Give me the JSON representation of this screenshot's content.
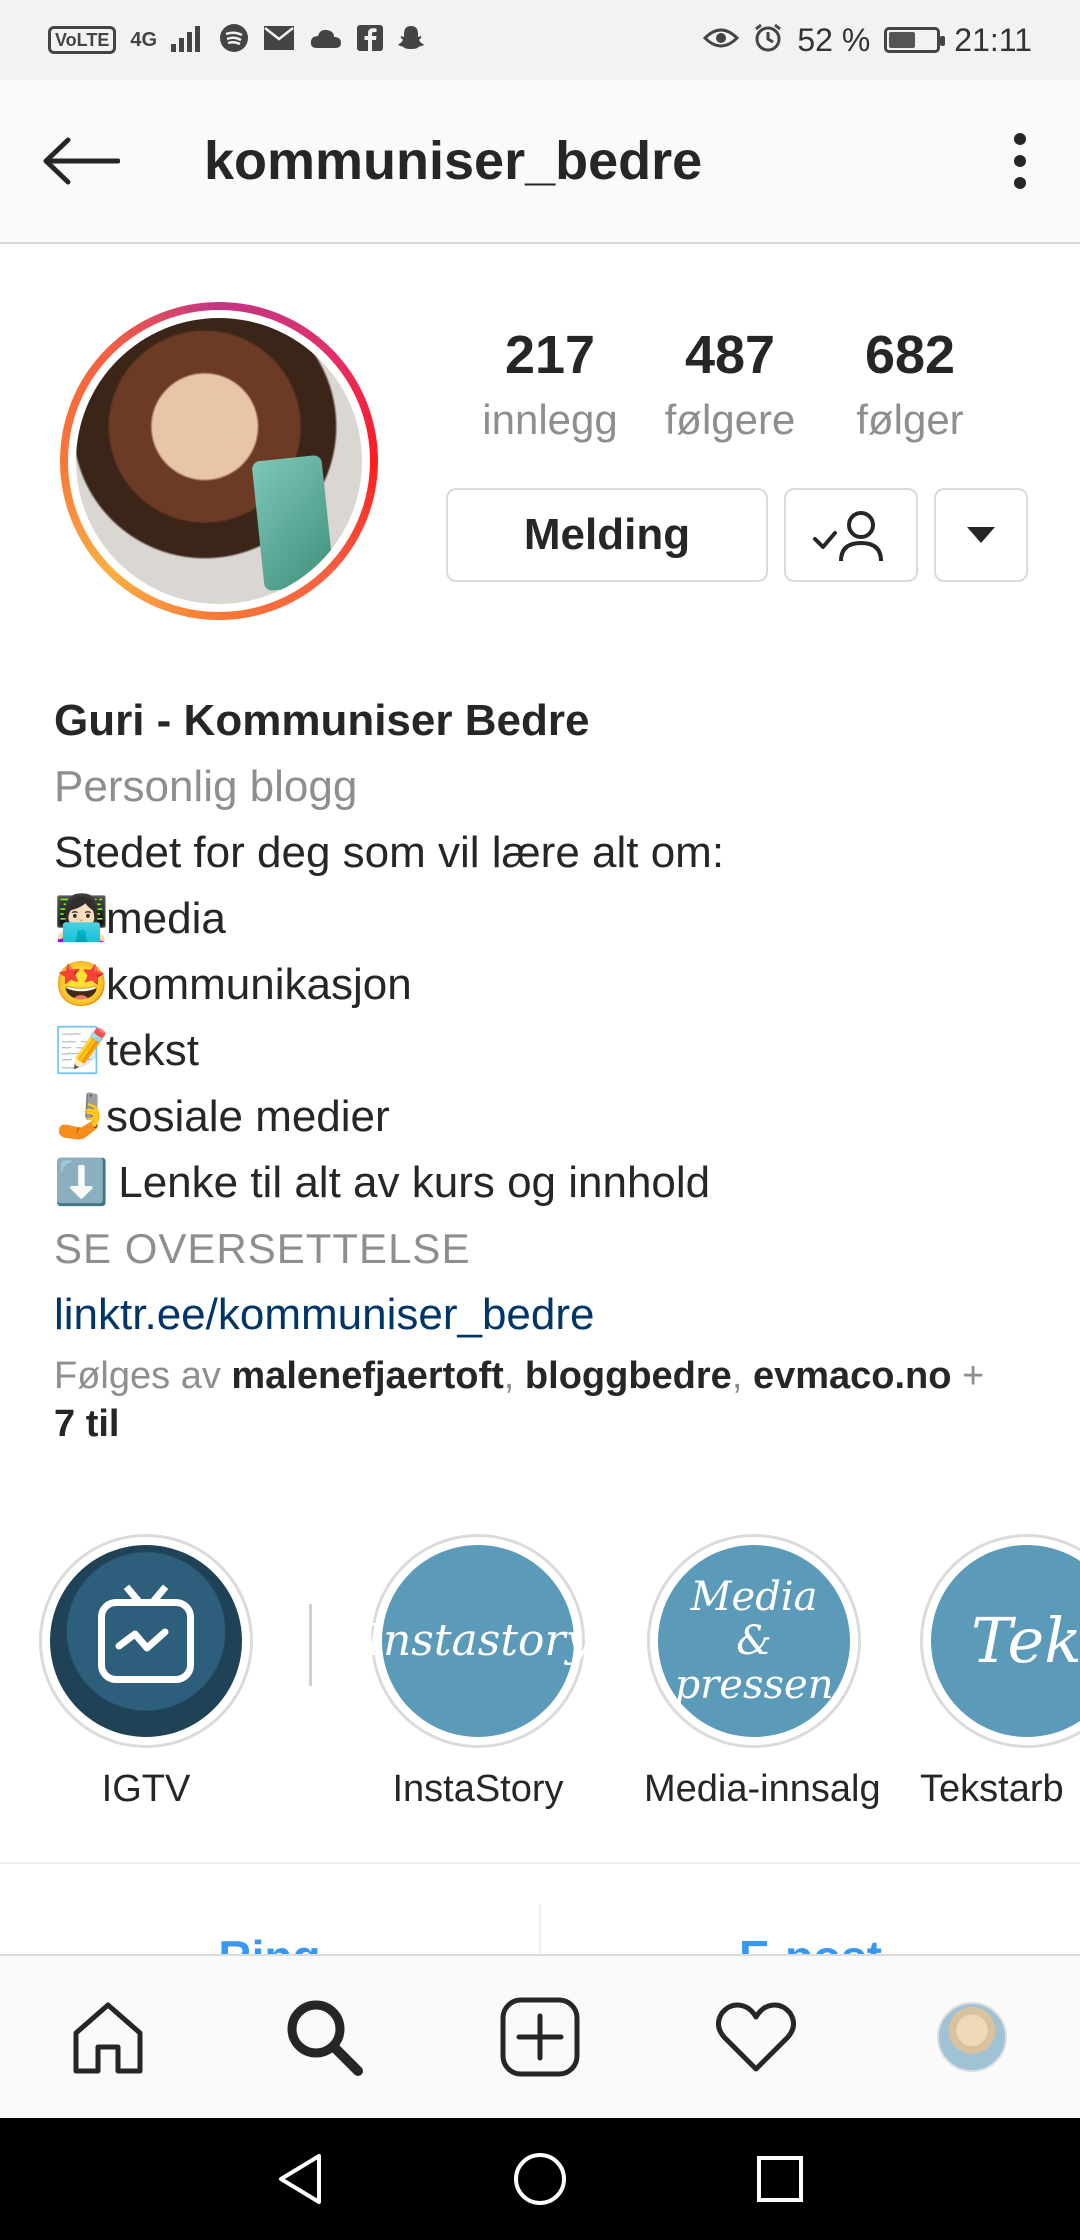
{
  "status_bar": {
    "volte": "VoLTE",
    "network": "4G",
    "battery_percent": "52 %",
    "battery_level": 0.52,
    "time": "21:11"
  },
  "header": {
    "title": "kommuniser_bedre"
  },
  "profile": {
    "stats": [
      {
        "count": "217",
        "label": "innlegg"
      },
      {
        "count": "487",
        "label": "følgere"
      },
      {
        "count": "682",
        "label": "følger"
      }
    ],
    "message_button": "Melding"
  },
  "bio": {
    "name": "Guri - Kommuniser Bedre",
    "category": "Personlig blogg",
    "intro": "Stedet for deg som vil lære alt om:",
    "lines": [
      {
        "emoji": "👩🏻‍💻",
        "text": "media"
      },
      {
        "emoji": "🤩",
        "text": "kommunikasjon"
      },
      {
        "emoji": "📝",
        "text": "tekst"
      },
      {
        "emoji": "🤳",
        "text": "sosiale medier"
      },
      {
        "emoji": "⬇️",
        "text": " Lenke til alt av kurs og innhold"
      }
    ],
    "translate": "SE OVERSETTELSE",
    "link": "linktr.ee/kommuniser_bedre"
  },
  "followed_by": {
    "prefix": "Følges av ",
    "users": [
      "malenefjaertoft",
      "bloggbedre",
      "evmaco.no"
    ],
    "sep": ", ",
    "plus": " + ",
    "more": "7 til"
  },
  "highlights": [
    {
      "label": "IGTV",
      "cover_text": ""
    },
    {
      "label": "InstaStory",
      "cover_text": "Instastory"
    },
    {
      "label": "Media-innsalg",
      "cover_text": "Media & pressen"
    },
    {
      "label": "Tekstarb",
      "cover_text": "Tekst"
    }
  ],
  "contact": {
    "call": "Ring",
    "email": "E-post"
  },
  "colors": {
    "link": "#003569",
    "accent_blue": "#3897f0",
    "muted": "#8e8e8e",
    "highlight_cover": "#5b9ab8"
  }
}
